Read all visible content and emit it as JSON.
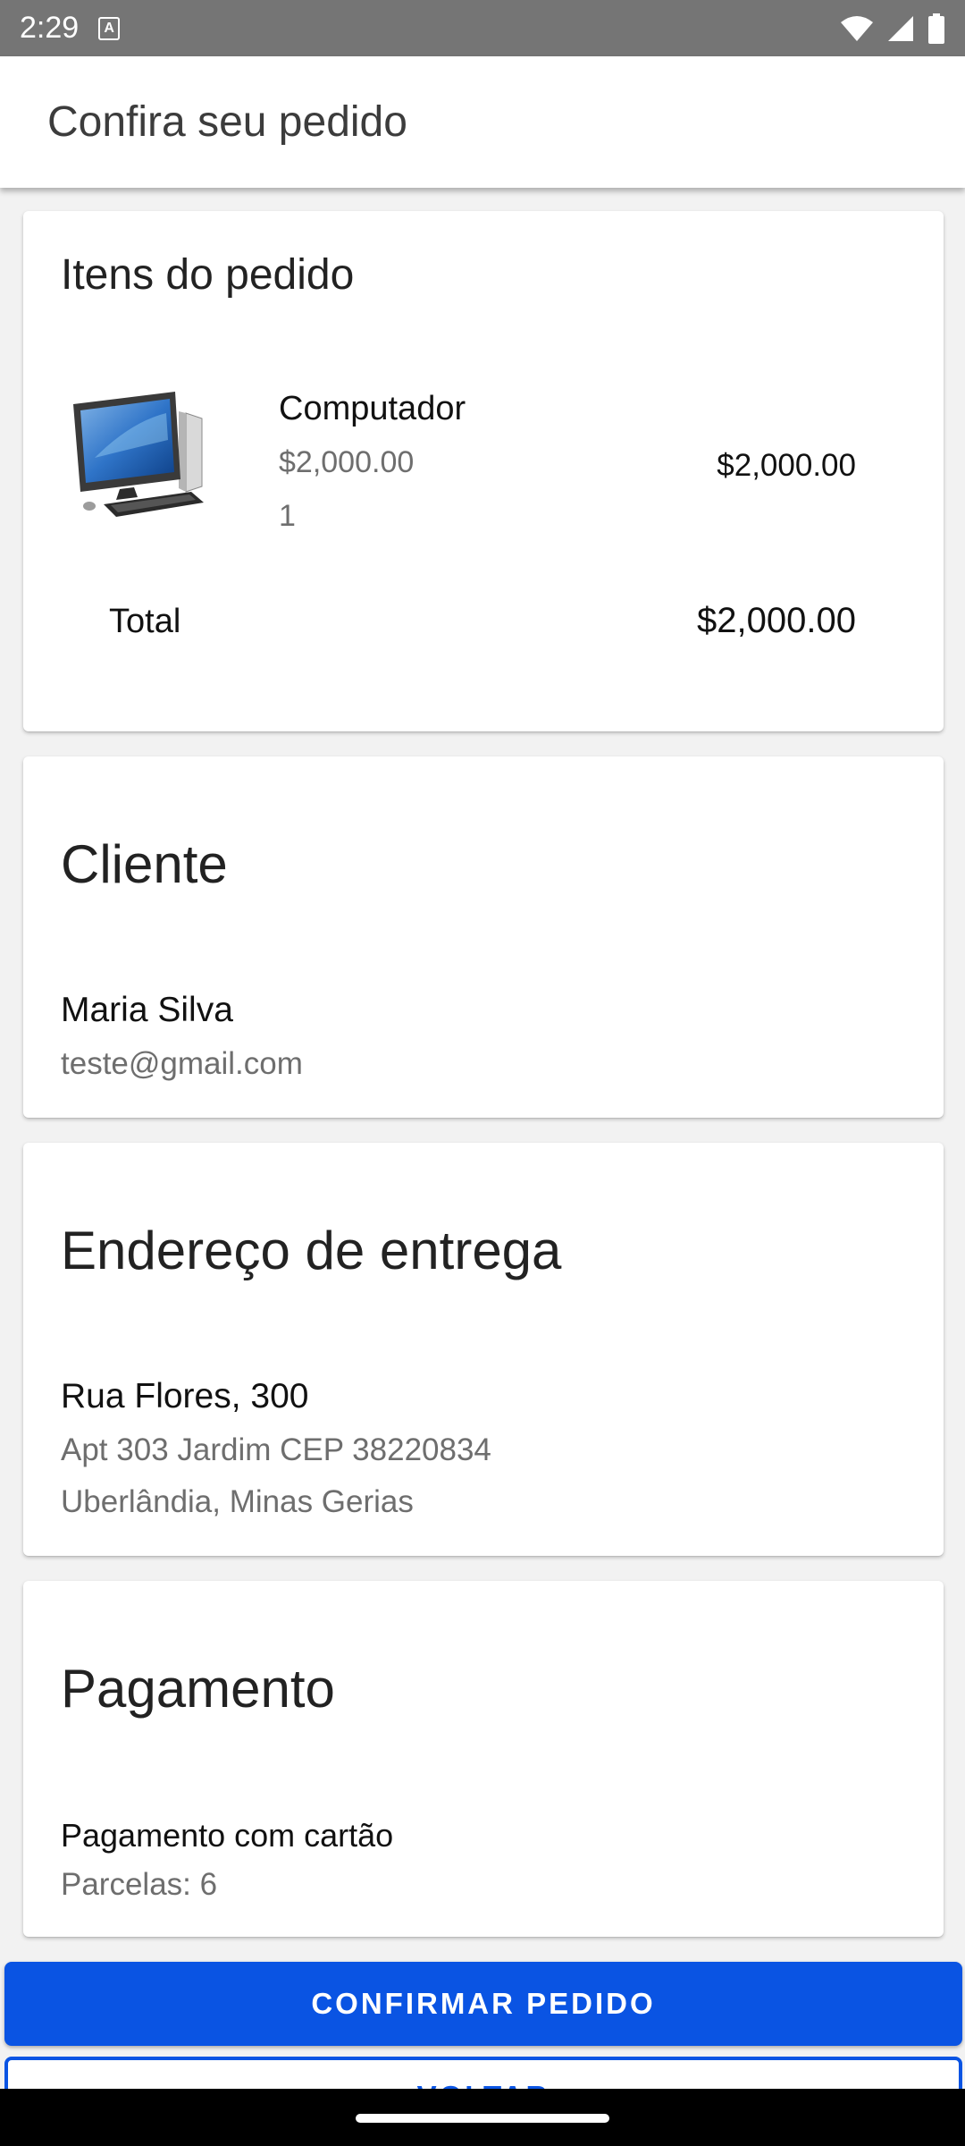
{
  "status_bar": {
    "time": "2:29",
    "app_icon_letter": "A",
    "icons": [
      "wifi-icon",
      "signal-icon",
      "battery-icon"
    ]
  },
  "app_bar": {
    "title": "Confira seu pedido"
  },
  "items_card": {
    "title": "Itens do pedido",
    "product": {
      "image": "computer-image",
      "name": "Computador",
      "unit_price": "$2,000.00",
      "quantity": "1",
      "subtotal": "$2,000.00"
    },
    "total_label": "Total",
    "total_value": "$2,000.00"
  },
  "client_card": {
    "title": "Cliente",
    "name": "Maria Silva",
    "email": "teste@gmail.com"
  },
  "address_card": {
    "title": "Endereço de entrega",
    "street": "Rua Flores, 300",
    "complement": "Apt 303 Jardim CEP 38220834",
    "city": "Uberlândia, Minas Gerias"
  },
  "payment_card": {
    "title": "Pagamento",
    "method": "Pagamento com cartão",
    "installments": "Parcelas: 6"
  },
  "buttons": {
    "confirm": "CONFIRMAR PEDIDO",
    "back": "VOLTAR"
  },
  "colors": {
    "primary": "#0a54e3",
    "status_bar": "#757575",
    "background": "#f2f2f2"
  }
}
